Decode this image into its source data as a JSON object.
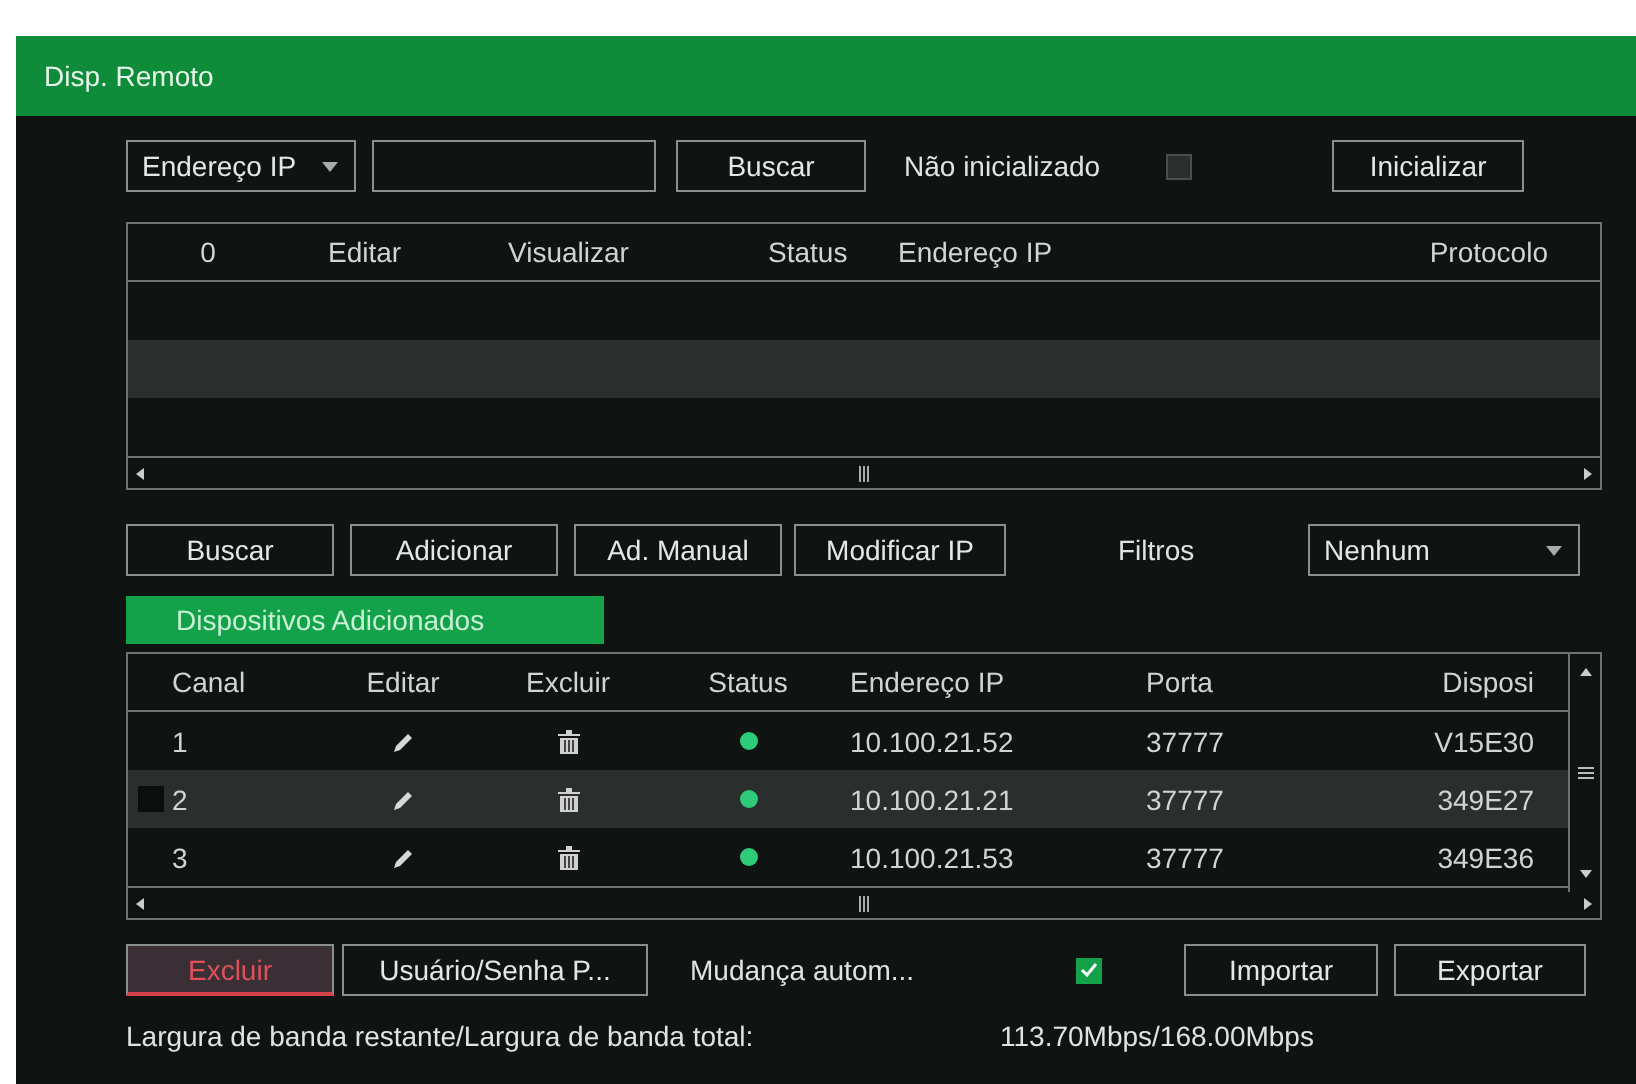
{
  "window": {
    "title": "Disp. Remoto"
  },
  "search_bar": {
    "dropdown": "Endereço IP",
    "search_button": "Buscar",
    "uninitialized_label": "Não inicializado",
    "uninitialized_checked": false,
    "initialize_button": "Inicializar"
  },
  "device_search_table": {
    "columns": [
      "0",
      "Editar",
      "Visualizar",
      "Status",
      "Endereço IP",
      "Protocolo"
    ]
  },
  "actions": [
    "Buscar",
    "Adicionar",
    "Ad. Manual",
    "Modificar IP"
  ],
  "filter": {
    "label": "Filtros",
    "value": "Nenhum"
  },
  "tabs": [
    {
      "label": "Dispositivos Adicionados",
      "selected": true
    }
  ],
  "added_table": {
    "columns": [
      "Canal",
      "Editar",
      "Excluir",
      "Status",
      "Endereço IP",
      "Porta",
      "Disposi"
    ],
    "rows": [
      {
        "channel": "1",
        "online": true,
        "ip": "10.100.21.52",
        "port": "37777",
        "device": "V15E30",
        "selected": false
      },
      {
        "channel": "2",
        "online": true,
        "ip": "10.100.21.21",
        "port": "37777",
        "device": "349E27",
        "selected": true
      },
      {
        "channel": "3",
        "online": true,
        "ip": "10.100.21.53",
        "port": "37777",
        "device": "349E36",
        "selected": false
      }
    ]
  },
  "bottom_bar": {
    "delete_button": "Excluir",
    "credentials_button": "Usuário/Senha P...",
    "auto_change_label": "Mudança autom...",
    "auto_change_checked": true,
    "import_button": "Importar",
    "export_button": "Exportar"
  },
  "bandwidth": {
    "label": "Largura de banda restante/Largura de banda total:",
    "value": "113.70Mbps/168.00Mbps"
  }
}
